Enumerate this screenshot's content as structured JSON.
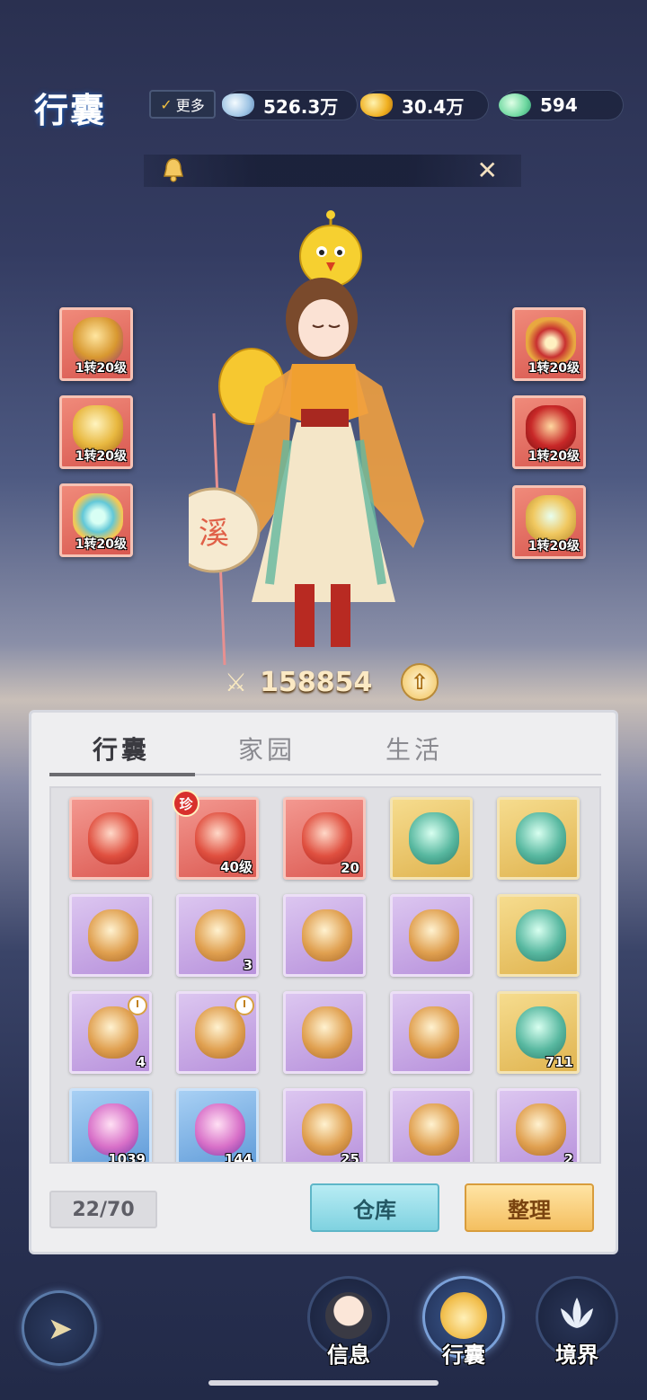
{
  "header": {
    "title": "行囊",
    "more_label": "更多",
    "currencies": [
      {
        "name": "silver-ingot-icon",
        "value": "526.3万"
      },
      {
        "name": "gold-ingot-icon",
        "value": "30.4万"
      },
      {
        "name": "jade-icon",
        "value": "594"
      }
    ]
  },
  "notice": {
    "text": ""
  },
  "equipment": {
    "left": [
      {
        "icon": "helmet-icon",
        "level": "1转20级"
      },
      {
        "icon": "teapot-icon",
        "level": "1转20级"
      },
      {
        "icon": "bracelet-icon",
        "level": "1转20级"
      }
    ],
    "right": [
      {
        "icon": "necklace-icon",
        "level": "1转20级"
      },
      {
        "icon": "armor-icon",
        "level": "1转20级"
      },
      {
        "icon": "boots-icon",
        "level": "1转20级"
      }
    ]
  },
  "character": {
    "lantern_char": "溪",
    "power": "158854"
  },
  "tabs": [
    {
      "label": "行囊",
      "active": true
    },
    {
      "label": "家园",
      "active": false
    },
    {
      "label": "生活",
      "active": false
    }
  ],
  "items": [
    {
      "icon": "lucky-bag-icon",
      "rarity": "red",
      "count": "",
      "timed": false,
      "rare": false
    },
    {
      "icon": "bracelet-icon",
      "rarity": "red",
      "count": "40级",
      "timed": false,
      "rare": true,
      "rare_label": "珍"
    },
    {
      "icon": "red-card-icon",
      "rarity": "red",
      "count": "20",
      "timed": false,
      "rare": false
    },
    {
      "icon": "bronze-cauldron-icon",
      "rarity": "gold",
      "count": "",
      "timed": false,
      "rare": false
    },
    {
      "icon": "jade-dragon-icon",
      "rarity": "gold",
      "count": "",
      "timed": false,
      "rare": false
    },
    {
      "icon": "jade-bird-icon",
      "rarity": "purple",
      "count": "",
      "timed": false,
      "rare": false
    },
    {
      "icon": "bronze-bowl-icon",
      "rarity": "purple",
      "count": "3",
      "timed": false,
      "rare": false
    },
    {
      "icon": "stone-statue-icon",
      "rarity": "purple",
      "count": "",
      "timed": false,
      "rare": false
    },
    {
      "icon": "broken-sword-icon",
      "rarity": "purple",
      "count": "",
      "timed": false,
      "rare": false
    },
    {
      "icon": "blue-crystal-icon",
      "rarity": "gold",
      "count": "",
      "timed": false,
      "rare": false
    },
    {
      "icon": "fruit-cluster-icon",
      "rarity": "purple",
      "count": "4",
      "timed": true,
      "rare": false
    },
    {
      "icon": "ice-shard-icon",
      "rarity": "purple",
      "count": "",
      "timed": true,
      "rare": false
    },
    {
      "icon": "gourd-scroll-icon",
      "rarity": "purple",
      "count": "",
      "timed": false,
      "rare": false
    },
    {
      "icon": "white-bag-icon",
      "rarity": "purple",
      "count": "",
      "timed": false,
      "rare": false
    },
    {
      "icon": "cultivation-book-icon",
      "rarity": "gold",
      "count": "711",
      "timed": false,
      "rare": false
    },
    {
      "icon": "pink-flower-icon",
      "rarity": "blue",
      "count": "1039",
      "timed": false,
      "rare": false
    },
    {
      "icon": "crystal-ball-icon",
      "rarity": "blue",
      "count": "144",
      "timed": false,
      "rare": false
    },
    {
      "icon": "red-gourd-icon",
      "rarity": "purple",
      "count": "25",
      "timed": false,
      "rare": false
    },
    {
      "icon": "yellow-gourd-icon",
      "rarity": "purple",
      "count": "",
      "timed": false,
      "rare": false
    },
    {
      "icon": "blue-gourd-icon",
      "rarity": "purple",
      "count": "2",
      "timed": false,
      "rare": false
    }
  ],
  "footer": {
    "slots": "22/70",
    "storage_label": "仓库",
    "sort_label": "整理"
  },
  "nav": [
    {
      "icon": "character-icon",
      "label": "信息",
      "active": false
    },
    {
      "icon": "bag-icon",
      "label": "行囊",
      "active": true
    },
    {
      "icon": "lotus-icon",
      "label": "境界",
      "active": false
    }
  ],
  "colors": {
    "red_rarity": "#dc5a52",
    "gold_rarity": "#e0b450",
    "purple_rarity": "#b892dc",
    "blue_rarity": "#5e9ad8"
  }
}
